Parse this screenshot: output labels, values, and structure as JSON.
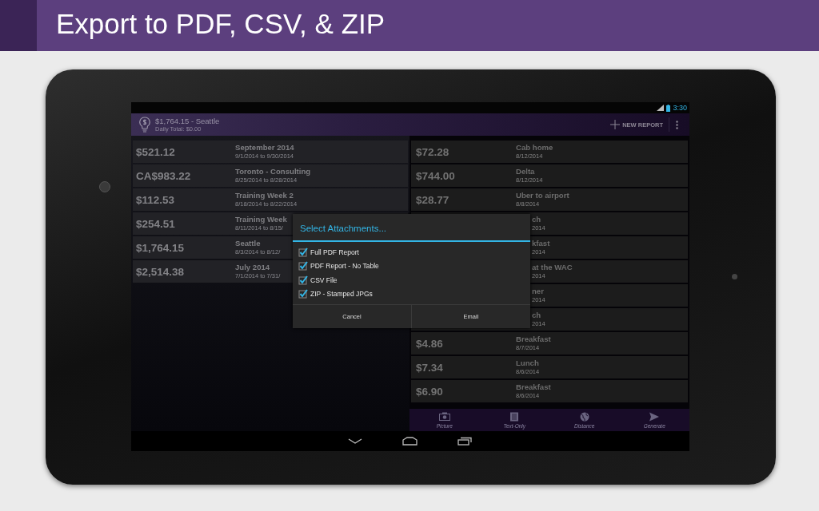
{
  "banner": {
    "title": "Export to PDF, CSV, & ZIP"
  },
  "status_bar": {
    "time": "3:30"
  },
  "action_bar": {
    "title": "$1,764.15 - Seattle",
    "subtitle": "Daily Total: $0.00",
    "action": "NEW REPORT"
  },
  "reports": [
    {
      "amount": "$521.12",
      "name": "September 2014",
      "dates": "9/1/2014 to 9/30/2014"
    },
    {
      "amount": "CA$983.22",
      "name": "Toronto - Consulting",
      "dates": "8/25/2014 to 8/28/2014"
    },
    {
      "amount": "$112.53",
      "name": "Training Week 2",
      "dates": "8/18/2014 to 8/22/2014"
    },
    {
      "amount": "$254.51",
      "name": "Training Week",
      "dates": "8/11/2014 to 8/15/"
    },
    {
      "amount": "$1,764.15",
      "name": "Seattle",
      "dates": "8/3/2014 to 8/12/"
    },
    {
      "amount": "$2,514.38",
      "name": "July 2014",
      "dates": "7/1/2014 to 7/31/"
    }
  ],
  "expenses": [
    {
      "kind": "full",
      "amount": "$72.28",
      "name": "Cab home",
      "date": "8/12/2014"
    },
    {
      "kind": "full",
      "amount": "$744.00",
      "name": "Delta",
      "date": "8/12/2014"
    },
    {
      "kind": "full",
      "amount": "$28.77",
      "name": "Uber to airport",
      "date": "8/8/2014"
    },
    {
      "kind": "covered",
      "name": "ch",
      "date": "2014"
    },
    {
      "kind": "covered",
      "name": "kfast",
      "date": "2014"
    },
    {
      "kind": "covered",
      "name": "at the WAC",
      "date": "2014"
    },
    {
      "kind": "covered",
      "name": "ner",
      "date": "2014"
    },
    {
      "kind": "covered",
      "name": "ch",
      "date": "2014"
    },
    {
      "kind": "full",
      "amount": "$4.86",
      "name": "Breakfast",
      "date": "8/7/2014"
    },
    {
      "kind": "full",
      "amount": "$7.34",
      "name": "Lunch",
      "date": "8/6/2014"
    },
    {
      "kind": "full",
      "amount": "$6.90",
      "name": "Breakfast",
      "date": "8/6/2014"
    }
  ],
  "bottom_tabs": [
    {
      "kind": "camera",
      "label": "Picture"
    },
    {
      "kind": "document",
      "label": "Text-Only"
    },
    {
      "kind": "globe",
      "label": "Distance"
    },
    {
      "kind": "send",
      "label": "Generate"
    }
  ],
  "dialog": {
    "title": "Select Attachments...",
    "options": [
      {
        "label": "Full PDF Report",
        "checked": true
      },
      {
        "label": "PDF Report - No Table",
        "checked": true
      },
      {
        "label": "CSV File",
        "checked": true
      },
      {
        "label": "ZIP - Stamped JPGs",
        "checked": true
      }
    ],
    "buttons": [
      "Cancel",
      "Email"
    ]
  }
}
